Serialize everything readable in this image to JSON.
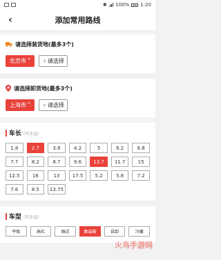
{
  "status": {
    "time": "1:20",
    "battery": "100%"
  },
  "nav": {
    "title": "添加常用路线",
    "back_icon": "back-arrow-icon"
  },
  "loading": {
    "label": "请选择装货地(最多3个)",
    "selected": [
      "北京市"
    ],
    "add_label": "请选择"
  },
  "unloading": {
    "label": "请选择卸货地(最多3个)",
    "selected": [
      "上海市"
    ],
    "add_label": "请选择"
  },
  "length": {
    "title": "车长",
    "hint": "(可多选)",
    "options": [
      "1.8",
      "2.7",
      "3.8",
      "4.2",
      "5",
      "6.2",
      "6.8",
      "7.7",
      "8.2",
      "8.7",
      "9.6",
      "13.7",
      "11.7",
      "15",
      "12.5",
      "16",
      "13",
      "17.5",
      "5.2",
      "5.8",
      "7.2",
      "7.6",
      "8.5",
      "13.75"
    ],
    "selected": [
      "2.7",
      "13.7"
    ]
  },
  "cartype": {
    "title": "车型",
    "hint": "(可多选)",
    "options": [
      "平板",
      "高栏",
      "厢式",
      "集装箱",
      "自卸",
      "冷藏"
    ],
    "selected": [
      "集装箱"
    ]
  },
  "watermark": "火鸟手游网",
  "colors": {
    "accent": "#e8423a",
    "loading_icon": "#f08a24"
  }
}
